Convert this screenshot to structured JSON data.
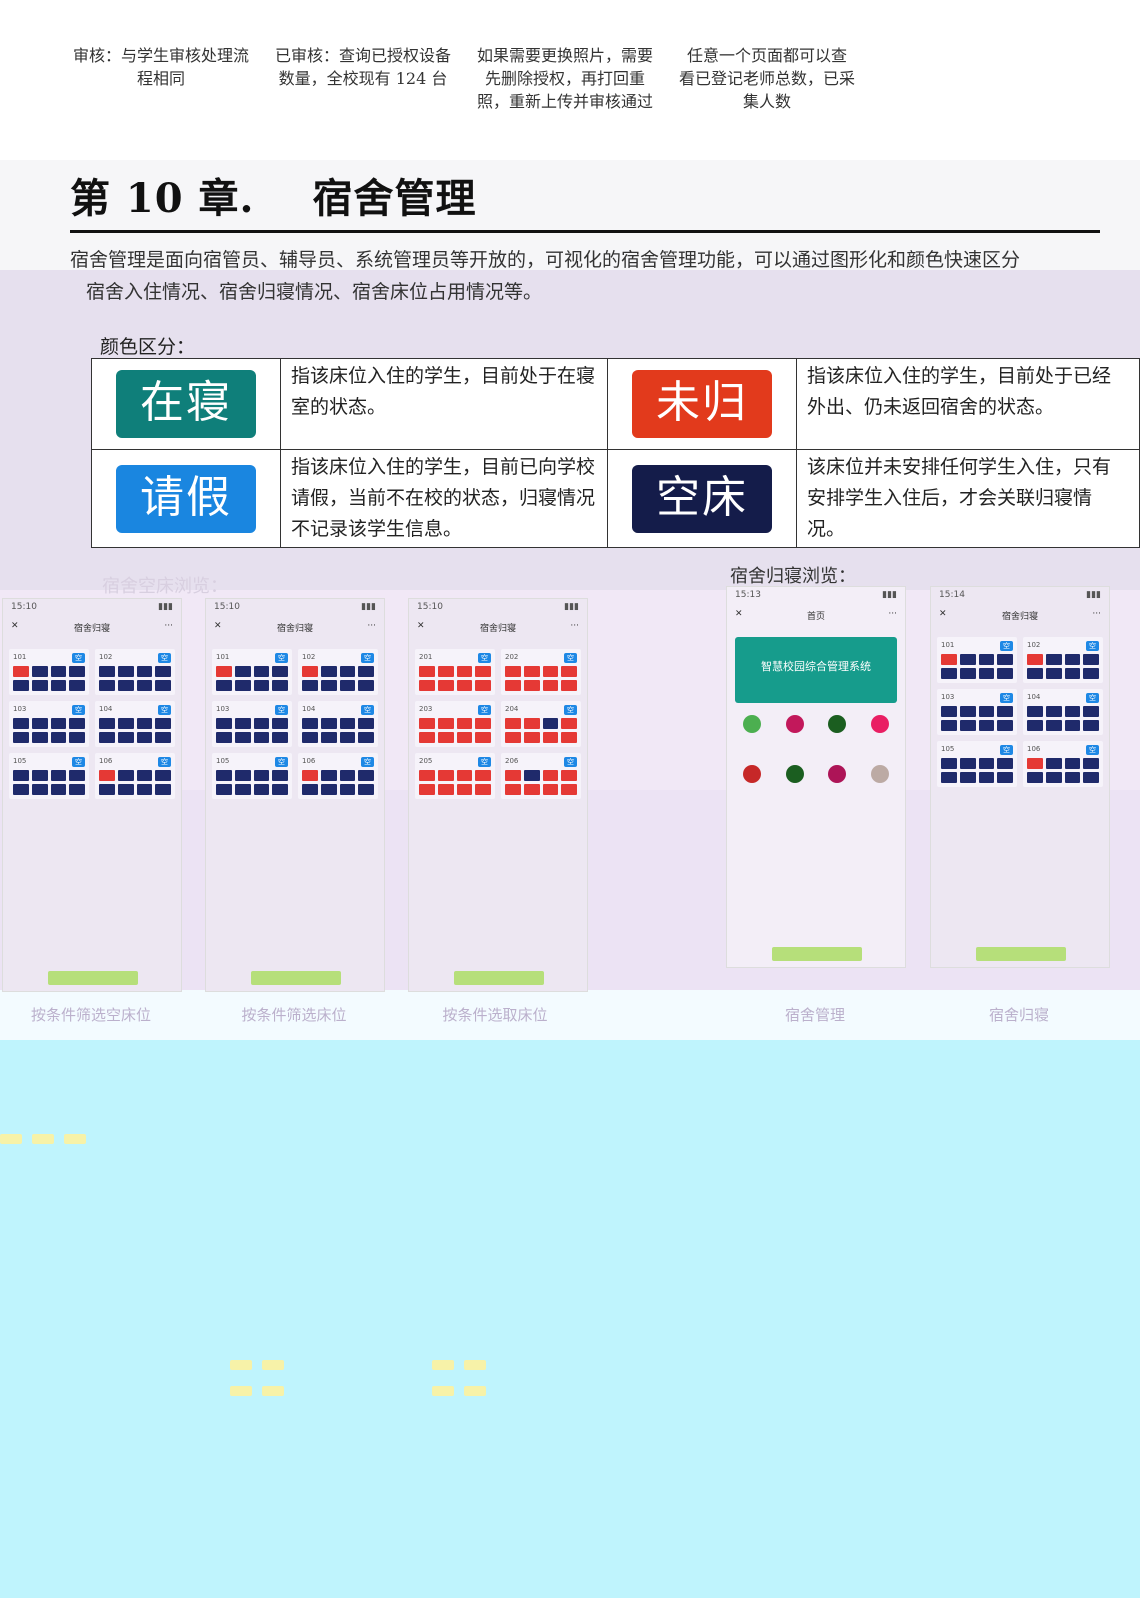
{
  "top_captions": [
    {
      "line1": "审核：与学生审核处理流",
      "line2": "程相同",
      "line3": ""
    },
    {
      "line1": "已审核：查询已授权设备",
      "line2": "数量，全校现有 124 台",
      "line3": ""
    },
    {
      "line1": "如果需要更换照片，需要",
      "line2": "先删除授权，再打回重",
      "line3": "照，重新上传并审核通过"
    },
    {
      "line1": "任意一个页面都可以查",
      "line2": "看已登记老师总数，已采",
      "line3": "集人数"
    }
  ],
  "chapter": {
    "number": "第 10 章.",
    "title": "宿舍管理"
  },
  "intro": {
    "line1": "宿舍管理是面向宿管员、辅导员、系统管理员等开放的，可视化的宿舍管理功能，可以通过图形化和颜色快速区分",
    "line2": "宿舍入住情况、宿舍归寝情况、宿舍床位占用情况等。"
  },
  "color_label": "颜色区分：",
  "legend": [
    {
      "tag": "在寝",
      "color": "#0f7f7a",
      "desc": "指该床位入住的学生，目前处于在寝室的状态。"
    },
    {
      "tag": "未归",
      "color": "#e23a1c",
      "desc": "指该床位入住的学生，目前处于已经外出、仍未返回宿舍的状态。"
    },
    {
      "tag": "请假",
      "color": "#1a86e0",
      "desc": "指该床位入住的学生，目前已向学校请假，当前不在校的状态，归寝情况不记录该学生信息。"
    },
    {
      "tag": "空床",
      "color": "#141c4a",
      "desc": "该床位并未安排任何学生入住，只有安排学生入住后，才会关联归寝情况。"
    }
  ],
  "section_labels": {
    "left": "宿舍空床浏览：",
    "right": "宿舍归寝浏览："
  },
  "phones": [
    {
      "title": "宿舍归寝",
      "time": "15:10"
    },
    {
      "title": "宿舍归寝",
      "time": "15:10"
    },
    {
      "title": "宿舍归寝",
      "time": "15:10"
    },
    {
      "title": "首页",
      "time": "15:13",
      "banner": "智慧校园综合管理系统"
    },
    {
      "title": "宿舍归寝",
      "time": "15:14"
    }
  ],
  "phone_captions": [
    "按条件筛选空床位",
    "按条件筛选床位",
    "按条件选取床位",
    "宿舍管理",
    "宿舍归寝"
  ]
}
